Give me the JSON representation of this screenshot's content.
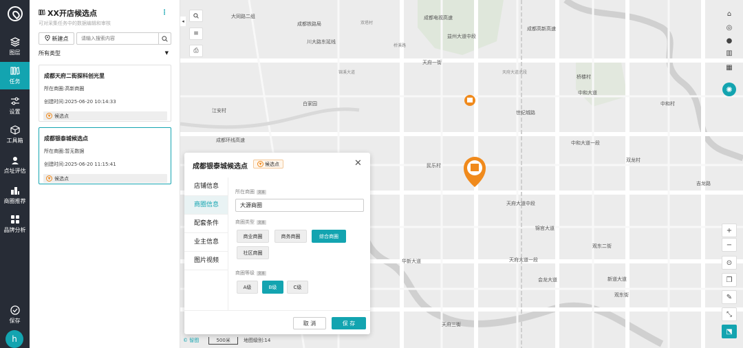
{
  "nav": {
    "items": [
      {
        "label": "图层",
        "icon": "layers-icon"
      },
      {
        "label": "任务",
        "icon": "books-icon"
      },
      {
        "label": "设置",
        "icon": "sliders-icon"
      },
      {
        "label": "工具箱",
        "icon": "cube-icon"
      },
      {
        "label": "点址评估",
        "icon": "location-user-icon"
      },
      {
        "label": "商圈推荐",
        "icon": "building-icon"
      },
      {
        "label": "品牌分析",
        "icon": "grid-icon"
      },
      {
        "label": "保存",
        "icon": "check-circle-icon"
      }
    ],
    "avatar": "h",
    "accent": "#13a4b0"
  },
  "panel": {
    "title": "XX开店候选点",
    "subtitle": "可对采集任务中的数据编辑和审核",
    "new_label": "新建点",
    "search_placeholder": "请输入搜索内容",
    "type_filter": "所有类型",
    "cards": [
      {
        "title": "成都天府二街探科创光里",
        "area": "所在商圈:高新商圈",
        "created": "创建时间:2025-06-20 10:14:33",
        "tag": "候选点"
      },
      {
        "title": "成都银泰城候选点",
        "area": "所在商圈:暂无数据",
        "created": "创建时间:2025-06-20 11:15:41",
        "tag": "候选点"
      }
    ]
  },
  "map": {
    "labels": {
      "l1": "大同路二组",
      "l2": "成都铁路局",
      "l3": "成都电视高速",
      "l4": "双塔村",
      "l5": "益州大道中段",
      "l6": "成都高新高速",
      "l7": "川大路东延线",
      "l8": "桥溪路",
      "l9": "天府一街",
      "l10": "天府大道北段",
      "l11": "锦溪大道",
      "l12": "桥楼村",
      "l13": "世纪城路",
      "l14": "中和大道",
      "l15": "中和大道一段",
      "l16": "天府大道中段",
      "l17": "双龙村",
      "l18": "民乐村",
      "l19": "锦官大道",
      "l20": "观东二街",
      "l21": "天府大道一段",
      "l22": "新道大道",
      "l23": "观东街",
      "l24": "华新大道",
      "l25": "会龙大道",
      "l26": "吉龙路",
      "l27": "江安村",
      "l28": "白家园",
      "l29": "成都环线高速",
      "l30": "天府三街",
      "l31": "中和村"
    },
    "scale": "500米",
    "level": "地图级别:14",
    "logo": "© 智图"
  },
  "modal": {
    "title": "成都银泰城候选点",
    "tag": "候选点",
    "tabs": [
      "店铺信息",
      "商圈信息",
      "配套条件",
      "业主信息",
      "图片视频"
    ],
    "active_tab": 1,
    "area_label": "所在商圈",
    "area_type_tag": "文本",
    "area_value": "大源商圈",
    "type_label": "商圈类型",
    "type_tag": "文本",
    "type_options": [
      "商业商圈",
      "商务商圈",
      "综合商圈",
      "社区商圈"
    ],
    "type_selected": "综合商圈",
    "level_label": "商圈等级",
    "level_tag": "文本",
    "level_options": [
      "A级",
      "B级",
      "C级"
    ],
    "level_selected": "B级",
    "cancel": "取 消",
    "save": "保 存"
  }
}
